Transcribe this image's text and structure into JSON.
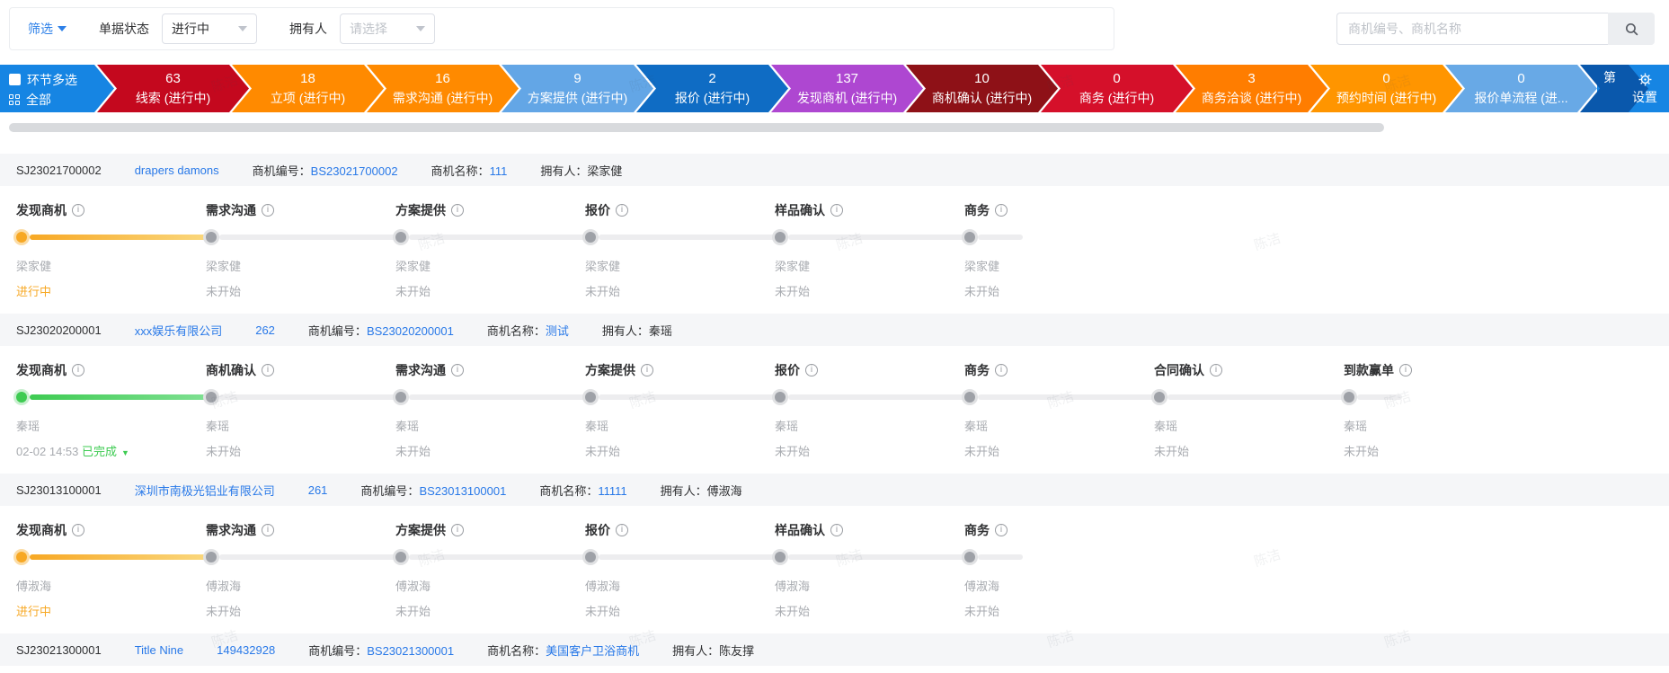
{
  "toolbar": {
    "filter_label": "筛选",
    "doc_status_label": "单据状态",
    "doc_status_value": "进行中",
    "owner_label": "拥有人",
    "owner_placeholder": "请选择",
    "search_placeholder": "商机编号、商机名称"
  },
  "funnel": {
    "checkbox_label": "环节多选",
    "all_label": "全部",
    "settings_label": "设置",
    "block_color": "#1685e3",
    "overflow": {
      "label": "第",
      "color": "#0a58ac"
    },
    "stages": [
      {
        "count": "63",
        "label": "线索 (进行中)",
        "color": "#c4081e"
      },
      {
        "count": "18",
        "label": "立项 (进行中)",
        "color": "#ff8a00"
      },
      {
        "count": "16",
        "label": "需求沟通 (进行中)",
        "color": "#ff8a00"
      },
      {
        "count": "9",
        "label": "方案提供 (进行中)",
        "color": "#63a6e6"
      },
      {
        "count": "2",
        "label": "报价 (进行中)",
        "color": "#0f6cc4"
      },
      {
        "count": "137",
        "label": "发现商机 (进行中)",
        "color": "#ae47d1"
      },
      {
        "count": "10",
        "label": "商机确认 (进行中)",
        "color": "#8e1117"
      },
      {
        "count": "0",
        "label": "商务 (进行中)",
        "color": "#d5102a"
      },
      {
        "count": "3",
        "label": "商务洽谈 (进行中)",
        "color": "#ff7d00"
      },
      {
        "count": "0",
        "label": "预约时间 (进行中)",
        "color": "#ff9500"
      },
      {
        "count": "0",
        "label": "报价单流程 (进...",
        "color": "#68a9e6"
      }
    ]
  },
  "row_labels": {
    "code": "商机编号：",
    "name": "商机名称：",
    "owner": "拥有人："
  },
  "rows": [
    {
      "id": "SJ23021700002",
      "company": "drapers damons",
      "num": "",
      "code": "BS23021700002",
      "name": "111",
      "owner": "梁家健",
      "stages": [
        {
          "title": "发现商机",
          "person": "梁家健",
          "status": "进行中",
          "state": "active"
        },
        {
          "title": "需求沟通",
          "person": "梁家健",
          "status": "未开始",
          "state": "pending"
        },
        {
          "title": "方案提供",
          "person": "梁家健",
          "status": "未开始",
          "state": "pending"
        },
        {
          "title": "报价",
          "person": "梁家健",
          "status": "未开始",
          "state": "pending"
        },
        {
          "title": "样品确认",
          "person": "梁家健",
          "status": "未开始",
          "state": "pending"
        },
        {
          "title": "商务",
          "person": "梁家健",
          "status": "未开始",
          "state": "pending"
        }
      ]
    },
    {
      "id": "SJ23020200001",
      "company": "xxx娱乐有限公司",
      "num": "262",
      "code": "BS23020200001",
      "name": "测试",
      "owner": "秦瑶",
      "stages": [
        {
          "title": "发现商机",
          "person": "秦瑶",
          "date": "02-02 14:53",
          "status": "已完成",
          "state": "done",
          "expand": true
        },
        {
          "title": "商机确认",
          "person": "秦瑶",
          "status": "未开始",
          "state": "pending"
        },
        {
          "title": "需求沟通",
          "person": "秦瑶",
          "status": "未开始",
          "state": "pending"
        },
        {
          "title": "方案提供",
          "person": "秦瑶",
          "status": "未开始",
          "state": "pending"
        },
        {
          "title": "报价",
          "person": "秦瑶",
          "status": "未开始",
          "state": "pending"
        },
        {
          "title": "商务",
          "person": "秦瑶",
          "status": "未开始",
          "state": "pending"
        },
        {
          "title": "合同确认",
          "person": "秦瑶",
          "status": "未开始",
          "state": "pending"
        },
        {
          "title": "到款赢单",
          "person": "秦瑶",
          "status": "未开始",
          "state": "pending"
        }
      ]
    },
    {
      "id": "SJ23013100001",
      "company": "深圳市南极光铝业有限公司",
      "num": "261",
      "code": "BS23013100001",
      "name": "11111",
      "owner": "傅淑海",
      "stages": [
        {
          "title": "发现商机",
          "person": "傅淑海",
          "status": "进行中",
          "state": "active"
        },
        {
          "title": "需求沟通",
          "person": "傅淑海",
          "status": "未开始",
          "state": "pending"
        },
        {
          "title": "方案提供",
          "person": "傅淑海",
          "status": "未开始",
          "state": "pending"
        },
        {
          "title": "报价",
          "person": "傅淑海",
          "status": "未开始",
          "state": "pending"
        },
        {
          "title": "样品确认",
          "person": "傅淑海",
          "status": "未开始",
          "state": "pending"
        },
        {
          "title": "商务",
          "person": "傅淑海",
          "status": "未开始",
          "state": "pending"
        }
      ]
    },
    {
      "id": "SJ23021300001",
      "company": "Title Nine",
      "num": "149432928",
      "code": "BS23021300001",
      "name": "美国客户卫浴商机",
      "owner": "陈友撑",
      "stages": []
    }
  ],
  "watermark": "陈洁",
  "colors": {
    "accent": "#2d80e8",
    "link": "#2979e8",
    "active": "#f7a824",
    "done": "#3ecb52",
    "pending_text": "#a8abb0"
  }
}
